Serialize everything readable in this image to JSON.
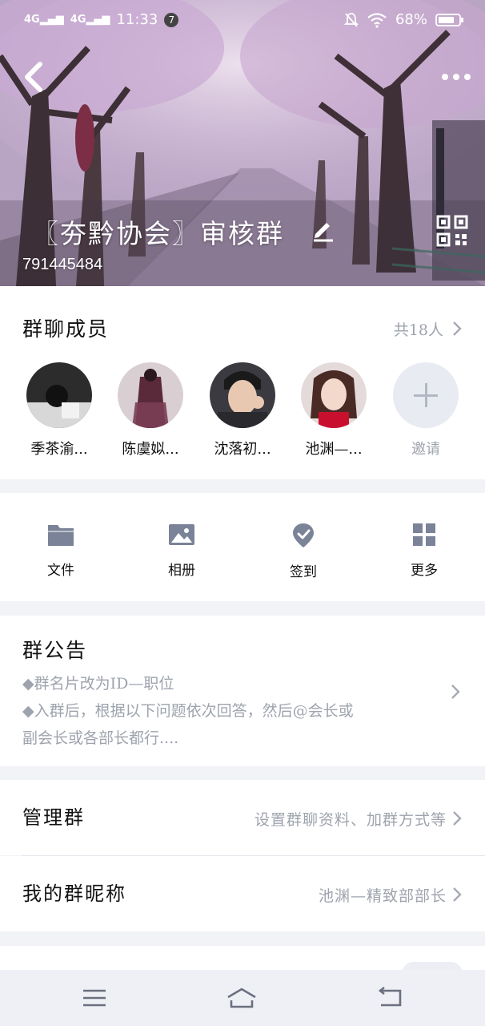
{
  "status_bar": {
    "signal1": "4G",
    "signal2": "4G",
    "time": "11:33",
    "notification_count": "7",
    "battery": "68%"
  },
  "header": {
    "group_name": "〖夯黔协会〗审核群",
    "group_id": "791445484"
  },
  "members": {
    "title": "群聊成员",
    "count": "共18人",
    "list": [
      {
        "name": "季茶渝..."
      },
      {
        "name": "陈虞姒..."
      },
      {
        "name": "沈落初..."
      },
      {
        "name": "池渊—..."
      }
    ],
    "invite_label": "邀请"
  },
  "tools": [
    {
      "label": "文件",
      "icon": "folder-icon"
    },
    {
      "label": "相册",
      "icon": "image-icon"
    },
    {
      "label": "签到",
      "icon": "checkin-pin-icon"
    },
    {
      "label": "更多",
      "icon": "grid-icon"
    }
  ],
  "notice": {
    "title": "群公告",
    "lines": [
      "◆群名片改为ID—职位",
      "◆入群后，根据以下问题依次回答，然后@会长或",
      "副会长或各部长都行...."
    ]
  },
  "manage": {
    "title": "管理群",
    "value": "设置群聊资料、加群方式等"
  },
  "nickname": {
    "title": "我的群昵称",
    "value": "池渊—精致部部长"
  },
  "colors": {
    "accent_gray": "#9ea3ad",
    "icon_gray": "#7b8398",
    "background": "#f2f3f7"
  }
}
